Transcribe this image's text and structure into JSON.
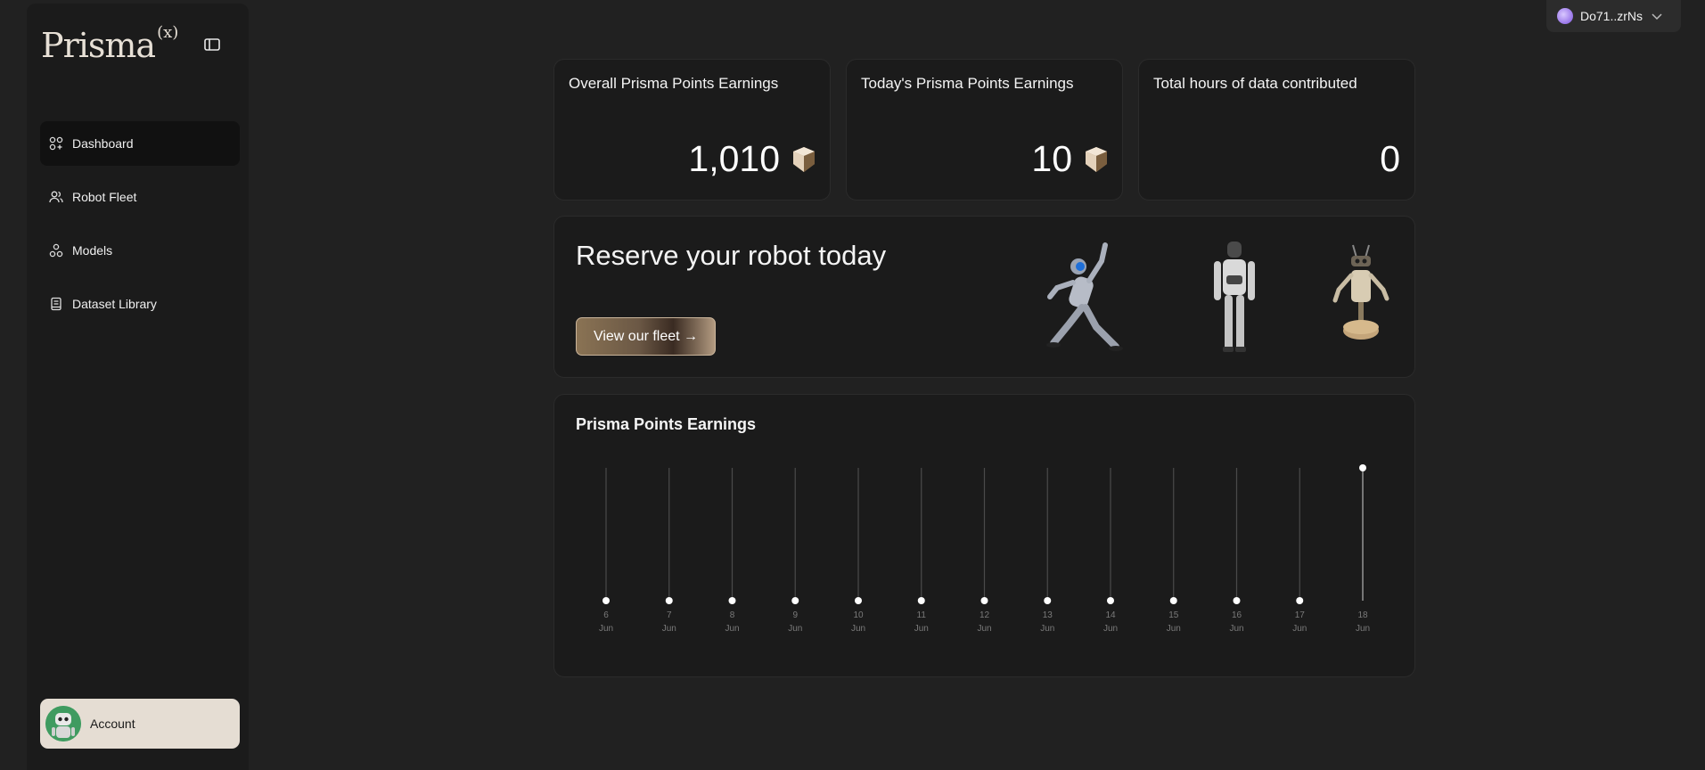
{
  "app": {
    "logo_text": "Prisma",
    "logo_superscript": "(x)"
  },
  "sidebar": {
    "items": [
      {
        "label": "Dashboard",
        "icon": "grid-icon",
        "active": true
      },
      {
        "label": "Robot Fleet",
        "icon": "users-icon",
        "active": false
      },
      {
        "label": "Models",
        "icon": "shapes-icon",
        "active": false
      },
      {
        "label": "Dataset Library",
        "icon": "book-icon",
        "active": false
      }
    ],
    "account_label": "Account"
  },
  "wallet": {
    "address": "Do71..zrNs"
  },
  "stats": {
    "overall": {
      "title": "Overall Prisma Points Earnings",
      "value": "1,010"
    },
    "today": {
      "title": "Today's Prisma Points Earnings",
      "value": "10"
    },
    "hours": {
      "title": "Total hours of data contributed",
      "value": "0"
    }
  },
  "banner": {
    "title": "Reserve your robot today",
    "button_label": "View our fleet →"
  },
  "chart": {
    "title": "Prisma Points Earnings"
  },
  "colors": {
    "background": "#212121",
    "card": "#1b1b1b",
    "account_bg": "#e5ddd3",
    "accent_gold": "#8a7354"
  },
  "chart_data": {
    "type": "line",
    "title": "Prisma Points Earnings",
    "x_days": [
      "6",
      "7",
      "8",
      "9",
      "10",
      "11",
      "12",
      "13",
      "14",
      "15",
      "16",
      "17",
      "18"
    ],
    "x_month": "Jun",
    "values": [
      0,
      0,
      0,
      0,
      0,
      0,
      0,
      0,
      0,
      0,
      0,
      0,
      10
    ],
    "ylim": [
      0,
      10
    ],
    "grid": false
  }
}
